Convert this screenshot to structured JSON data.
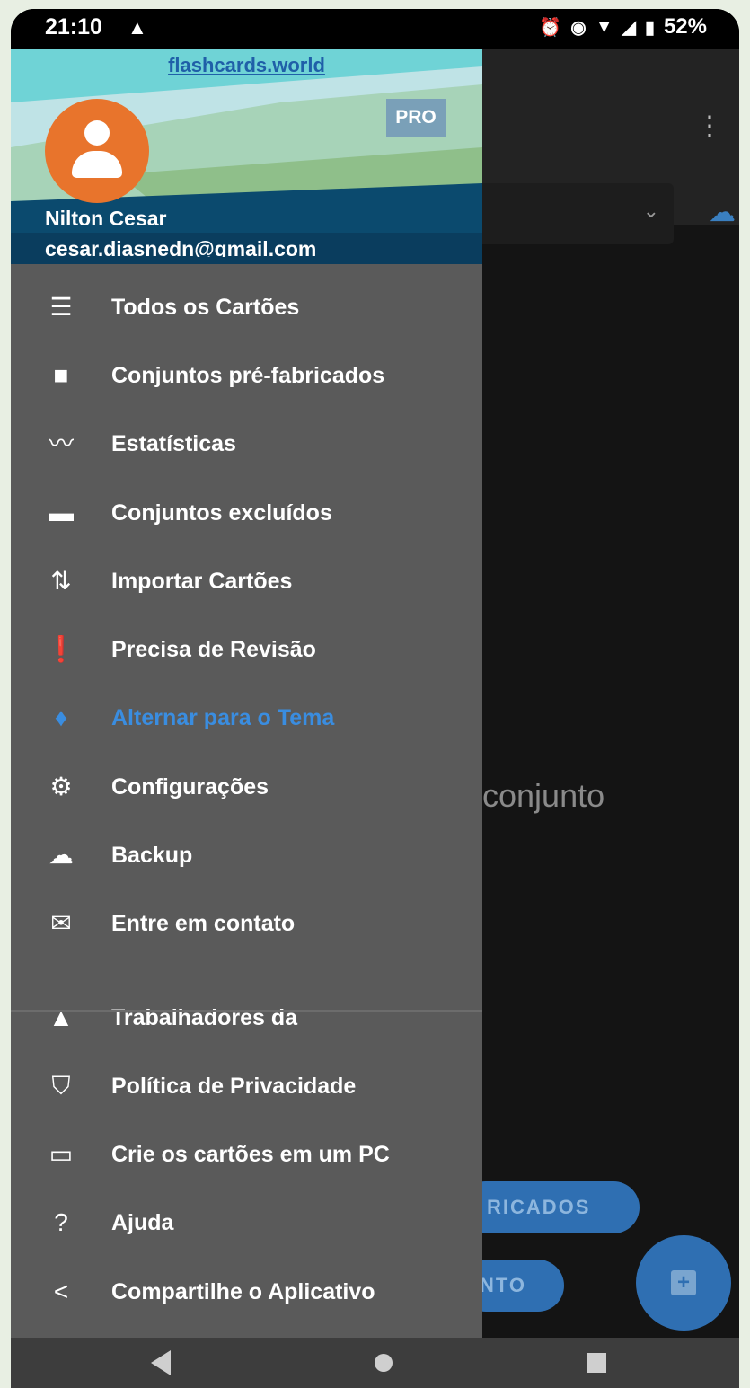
{
  "status_bar": {
    "time": "21:10",
    "battery": "52%"
  },
  "app": {
    "body_text": "conjunto",
    "pill_1": "RICADOS",
    "pill_2": "NTO"
  },
  "drawer": {
    "site": "flashcards.world",
    "badge": "PRO",
    "user_name": "Nilton Cesar",
    "user_email": "cesar.diasnedn@gmail.com",
    "items": [
      {
        "label": "Todos os Cartões",
        "icon": "list-icon"
      },
      {
        "label": "Conjuntos pré-fabricados",
        "icon": "briefcase-icon"
      },
      {
        "label": "Estatísticas",
        "icon": "trending-icon"
      },
      {
        "label": "Conjuntos excluídos",
        "icon": "trash-icon"
      },
      {
        "label": "Importar Cartões",
        "icon": "import-icon"
      },
      {
        "label": "Precisa de Revisão",
        "icon": "feedback-icon"
      },
      {
        "label": "Alternar para o Tema",
        "icon": "lightbulb-icon"
      },
      {
        "label": "Configurações",
        "icon": "gear-icon"
      },
      {
        "label": "Backup",
        "icon": "cloud-upload-icon"
      },
      {
        "label": "Entre em contato",
        "icon": "mail-icon"
      },
      {
        "label": "Trabalhadores da",
        "icon": "school-icon"
      },
      {
        "label": "Política de Privacidade",
        "icon": "shield-icon"
      },
      {
        "label": "Crie os cartões em um PC",
        "icon": "laptop-icon"
      },
      {
        "label": "Ajuda",
        "icon": "help-icon"
      },
      {
        "label": "Compartilhe o Aplicativo",
        "icon": "share-icon"
      }
    ]
  },
  "colors": {
    "accent": "#3a8de0",
    "drawer_bg": "#5a5a5a",
    "avatar": "#e8742c"
  }
}
